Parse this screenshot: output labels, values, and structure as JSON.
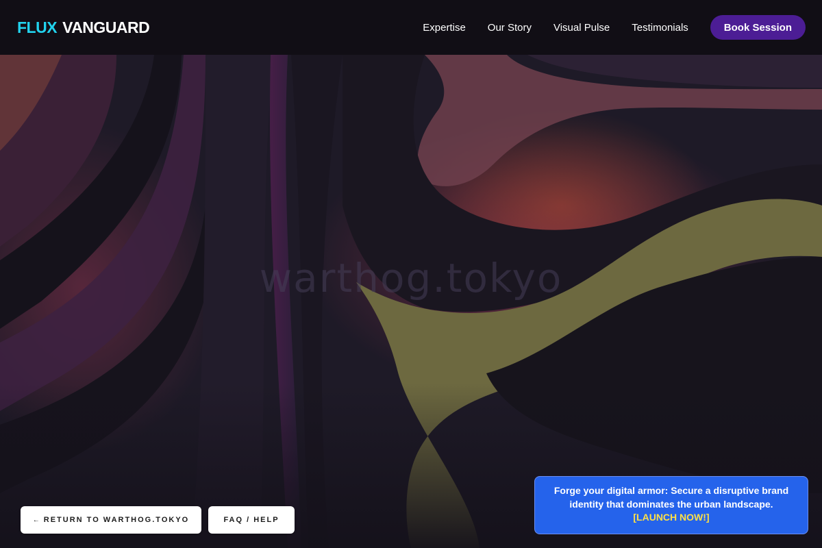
{
  "header": {
    "logo_accent": "FLUX",
    "logo_rest": "VANGUARD",
    "nav": [
      {
        "label": "Expertise"
      },
      {
        "label": "Our Story"
      },
      {
        "label": "Visual Pulse"
      },
      {
        "label": "Testimonials"
      }
    ],
    "cta_label": "Book Session"
  },
  "hero": {
    "watermark": "warthog.tokyo"
  },
  "footer_buttons": {
    "return_arrow": "←",
    "return_label": "RETURN TO WARTHOG.TOKYO",
    "faq_label": "FAQ / HELP"
  },
  "promo": {
    "text": "Forge your digital armor: Secure a disruptive brand identity that dominates the urban landscape.",
    "cta": "[LAUNCH NOW!]"
  },
  "colors": {
    "logo_accent": "#22d3ee",
    "cta_button": "#4c1d95",
    "promo_background": "#2563eb",
    "promo_cta": "#fde047",
    "header_background": "#100e14"
  }
}
